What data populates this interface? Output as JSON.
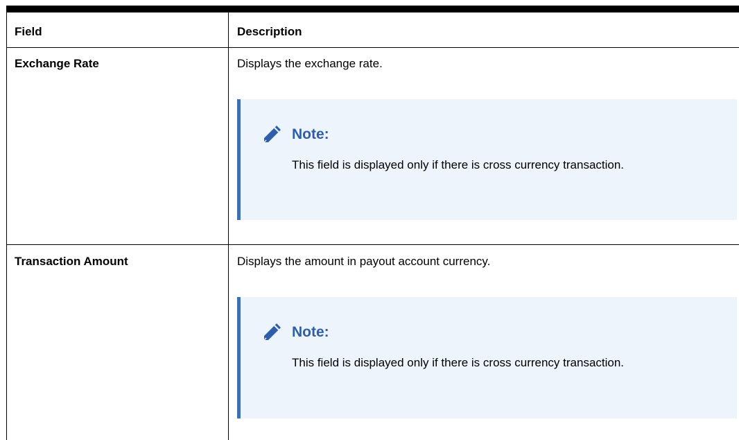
{
  "table": {
    "headers": {
      "field": "Field",
      "description": "Description"
    },
    "rows": [
      {
        "field": "Exchange Rate",
        "description": "Displays the exchange rate.",
        "note": {
          "title": "Note:",
          "body": "This field is displayed only if there is cross currency transaction."
        }
      },
      {
        "field": "Transaction Amount",
        "description": "Displays the amount in payout account currency.",
        "note": {
          "title": "Note:",
          "body": "This field is displayed only if there is cross currency transaction."
        }
      }
    ]
  },
  "colors": {
    "note_bg": "#eef4fc",
    "note_accent": "#3f6fb0",
    "note_title": "#2f5ea8"
  },
  "icons": {
    "note": "pencil-icon"
  }
}
